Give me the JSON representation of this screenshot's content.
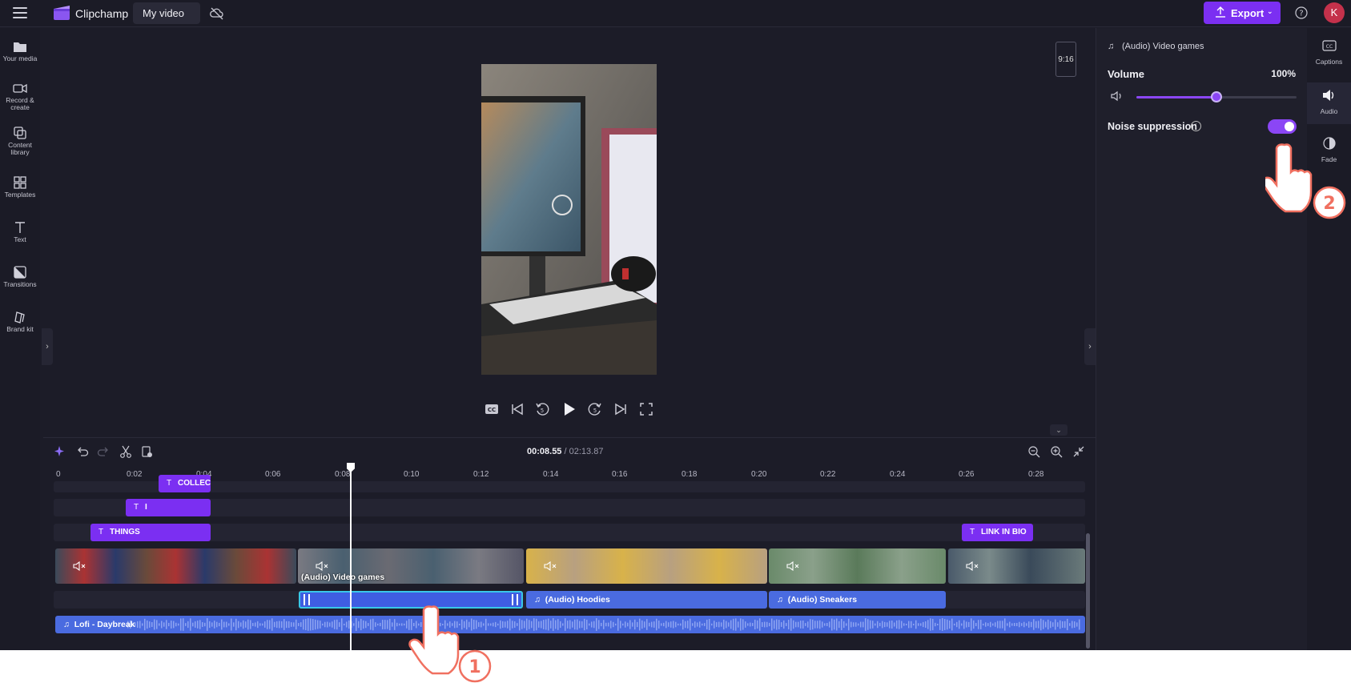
{
  "topbar": {
    "app_name": "Clipchamp",
    "video_title": "My video",
    "export_label": "Export",
    "avatar_initial": "K"
  },
  "sidebar": {
    "items": [
      {
        "label": "Your media"
      },
      {
        "label": "Record &",
        "label2": "create"
      },
      {
        "label": "Content",
        "label2": "library"
      },
      {
        "label": "Templates"
      },
      {
        "label": "Text"
      },
      {
        "label": "Transitions"
      },
      {
        "label": "Brand kit"
      }
    ]
  },
  "preview": {
    "aspect_ratio": "9:16"
  },
  "properties": {
    "title": "(Audio) Video games",
    "volume_label": "Volume",
    "volume_value": "100%",
    "volume_level": 0.5,
    "noise_label": "Noise suppression",
    "noise_on": true
  },
  "rail": {
    "items": [
      {
        "label": "Captions",
        "icon": "captions-icon"
      },
      {
        "label": "Audio",
        "icon": "audio-icon"
      },
      {
        "label": "Fade",
        "icon": "fade-icon"
      }
    ]
  },
  "timeline": {
    "current_time": "00:08.55",
    "total_time": "/ 02:13.87",
    "ticks": [
      "0",
      "0:02",
      "0:04",
      "0:06",
      "0:08",
      "0:10",
      "0:12",
      "0:14",
      "0:16",
      "0:18",
      "0:20",
      "0:22",
      "0:24",
      "0:26",
      "0:28"
    ],
    "text_clips": [
      "COLLEC",
      "I",
      "THINGS",
      "LINK IN BIO"
    ],
    "video_clip_label": "(Audio) Video games",
    "audio_clips": [
      "(Audio) Hoodies",
      "(Audio) Sneakers"
    ],
    "music_clip": "Lofi - Daybreak"
  },
  "annotations": {
    "step1": "1",
    "step2": "2"
  },
  "colors": {
    "accent": "#7b2ff2",
    "audio_clip": "#4a6be0",
    "selected_border": "#39c7e8",
    "background": "#1c1c28",
    "callout": "#f07060"
  }
}
